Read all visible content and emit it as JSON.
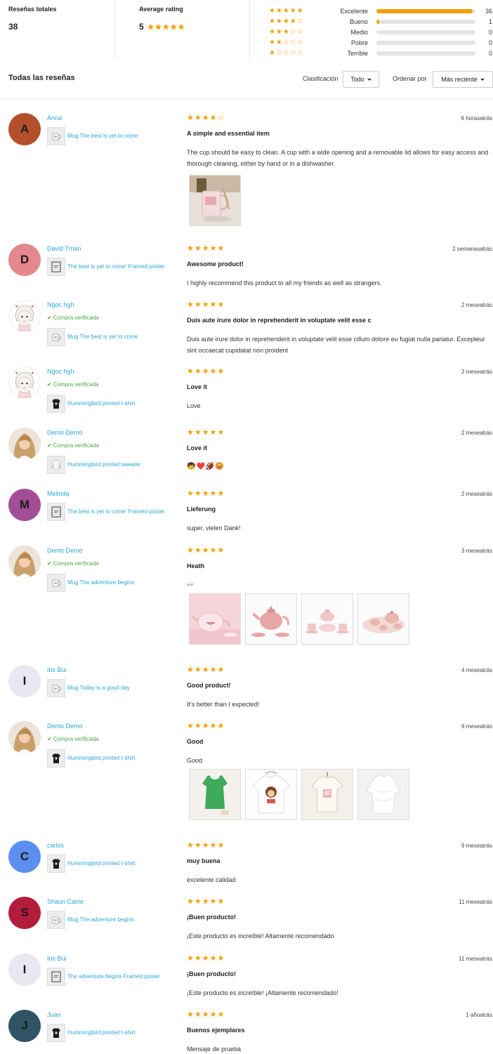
{
  "summary": {
    "total_label": "Reseñas totales",
    "total_value": "38",
    "avg_label": "Average rating",
    "avg_value": "5",
    "avg_stars": "★★★★★",
    "breakdown": [
      {
        "stars": "★★★★★",
        "label": "Excelente",
        "count": "36",
        "fraction": 0.97
      },
      {
        "stars": "★★★★☆",
        "label": "Bueno",
        "count": "1",
        "fraction": 0.03
      },
      {
        "stars": "★★★☆☆",
        "label": "Medio",
        "count": "0",
        "fraction": 0
      },
      {
        "stars": "★★☆☆☆",
        "label": "Pobre",
        "count": "0",
        "fraction": 0
      },
      {
        "stars": "★☆☆☆☆",
        "label": "Terrible",
        "count": "0",
        "fraction": 0
      }
    ]
  },
  "toolbar": {
    "title": "Todas las reseñas",
    "filter_label": "Clasificación",
    "filter_value": "Todo",
    "sort_label": "Ordenar por",
    "sort_value": "Más reciente"
  },
  "reviews": [
    {
      "name": "Anna",
      "avatar_letter": "A",
      "avatar_color": "#b3502a",
      "verified": "",
      "product": "Mug The best is yet to come",
      "product_icon": "mug",
      "rating": "★★★★☆",
      "time": "6 horasatrás",
      "title": "A simple and essential item",
      "body": "The cup should be easy to clean. A cup with a wide opening and a removable lid allows for easy access and thorough cleaning, either by hand or in a dishwasher.",
      "photos": [
        "pink-mug"
      ]
    },
    {
      "name": "David Tman",
      "avatar_letter": "D",
      "avatar_color": "#e5888d",
      "verified": "",
      "product": "The best is yet to come' Framed poster",
      "product_icon": "poster",
      "rating": "★★★★★",
      "time": "2 semanasatrás",
      "title": "Awesome product!",
      "body": "I highly recommend this product to all my friends as well as strangers.",
      "photos": []
    },
    {
      "name": "Ngoc hgh",
      "avatar_letter": "",
      "avatar_color": "#ffffff",
      "avatar_image": "anime-girl",
      "verified": "Compra verificada",
      "product": "Mug The best is yet to come",
      "product_icon": "mug",
      "rating": "★★★★★",
      "time": "2 meseatrás",
      "title": "Duis aute irure dolor in reprehenderit in voluptate velit esse c",
      "body": "Duis aute irure dolor in reprehenderit in voluptate velit esse cillum dolore eu fugiat nulla pariatur. Excepteur sint occaecat cupidatat non proident",
      "photos": []
    },
    {
      "name": "Ngoc hgh",
      "avatar_letter": "",
      "avatar_color": "#ffffff",
      "avatar_image": "anime-girl",
      "verified": "Compra verificada",
      "product": "Hummingbird printed t-shirt",
      "product_icon": "tshirt-black",
      "rating": "★★★★★",
      "time": "2 meseatrás",
      "title": "Love it",
      "body": "Love",
      "photos": []
    },
    {
      "name": "Demo Demo",
      "avatar_letter": "",
      "avatar_color": "#e8c9a6",
      "avatar_image": "woman-photo",
      "verified": "Compra verificada",
      "product": "Hummingbird printed sweater",
      "product_icon": "sweater",
      "rating": "★★★★★",
      "time": "2 meseatrás",
      "title": "Love it",
      "body": "🧒❤️🏈😡",
      "photos": []
    },
    {
      "name": "Melinda",
      "avatar_letter": "M",
      "avatar_color": "#a24e96",
      "verified": "",
      "product": "The best is yet to come' Framed poster",
      "product_icon": "poster",
      "rating": "★★★★★",
      "time": "2 meseatrás",
      "title": "Lieferung",
      "body": "super, vielen Dank!",
      "photos": []
    },
    {
      "name": "Demo Demo",
      "avatar_letter": "",
      "avatar_color": "#e8c9a6",
      "avatar_image": "woman-photo",
      "verified": "Compra verificada",
      "product": "Mug The adventure begins",
      "product_icon": "mug",
      "rating": "★★★★★",
      "time": "3 meseatrás",
      "title": "Heath",
      "body": "〰︎",
      "photos": [
        "pink-teapot-set",
        "pink-teapot",
        "pink-cups-stack",
        "pink-tea-service"
      ]
    },
    {
      "name": "Iris Bui",
      "avatar_letter": "I",
      "avatar_color": "#e9e7f0",
      "verified": "",
      "product": "Mug Today is a good day",
      "product_icon": "mug",
      "rating": "★★★★★",
      "time": "4 meseatrás",
      "title": "Good product!",
      "body": "It's better than I expected!",
      "photos": []
    },
    {
      "name": "Demo Demo",
      "avatar_letter": "",
      "avatar_color": "#e8c9a6",
      "avatar_image": "woman-photo",
      "verified": "Compra verificada",
      "product": "Hummingbird printed t-shirt",
      "product_icon": "tshirt-black",
      "rating": "★★★★★",
      "time": "9 meseatrás",
      "title": "Good",
      "body": "Good",
      "photos": [
        "green-dress",
        "white-tee",
        "cream-top",
        "white-blouse"
      ]
    },
    {
      "name": "carlos",
      "avatar_letter": "C",
      "avatar_color": "#5b8ff0",
      "verified": "",
      "product": "Hummingbird printed t-shirt",
      "product_icon": "tshirt-black",
      "rating": "★★★★★",
      "time": "9 meseatrás",
      "title": "muy buena",
      "body": "excelente calidad",
      "photos": []
    },
    {
      "name": "Shaun Caine",
      "avatar_letter": "S",
      "avatar_color": "#b31d3c",
      "verified": "",
      "product": "Mug The adventure begins",
      "product_icon": "mug",
      "rating": "★★★★★",
      "time": "11 meseatrás",
      "title": "¡Buen producto!",
      "body": "¡Este producto es increíble! Altamente recomendado",
      "photos": []
    },
    {
      "name": "Iris Bui",
      "avatar_letter": "I",
      "avatar_color": "#e9e7f0",
      "verified": "",
      "product": "The adventure begins Framed poster",
      "product_icon": "poster",
      "rating": "★★★★★",
      "time": "11 meseatrás",
      "title": "¡Buen producto!",
      "body": "¡Este producto es increíble! ¡Altamente recomendado!",
      "photos": []
    },
    {
      "name": "Juan",
      "avatar_letter": "J",
      "avatar_color": "#2f5466",
      "verified": "",
      "product": "Hummingbird printed t-shirt",
      "product_icon": "tshirt-black",
      "rating": "★★★★★",
      "time": "1 añoatrás",
      "title": "Buenos ejemplares",
      "body": "Mensaje de prueba",
      "photos": []
    }
  ]
}
